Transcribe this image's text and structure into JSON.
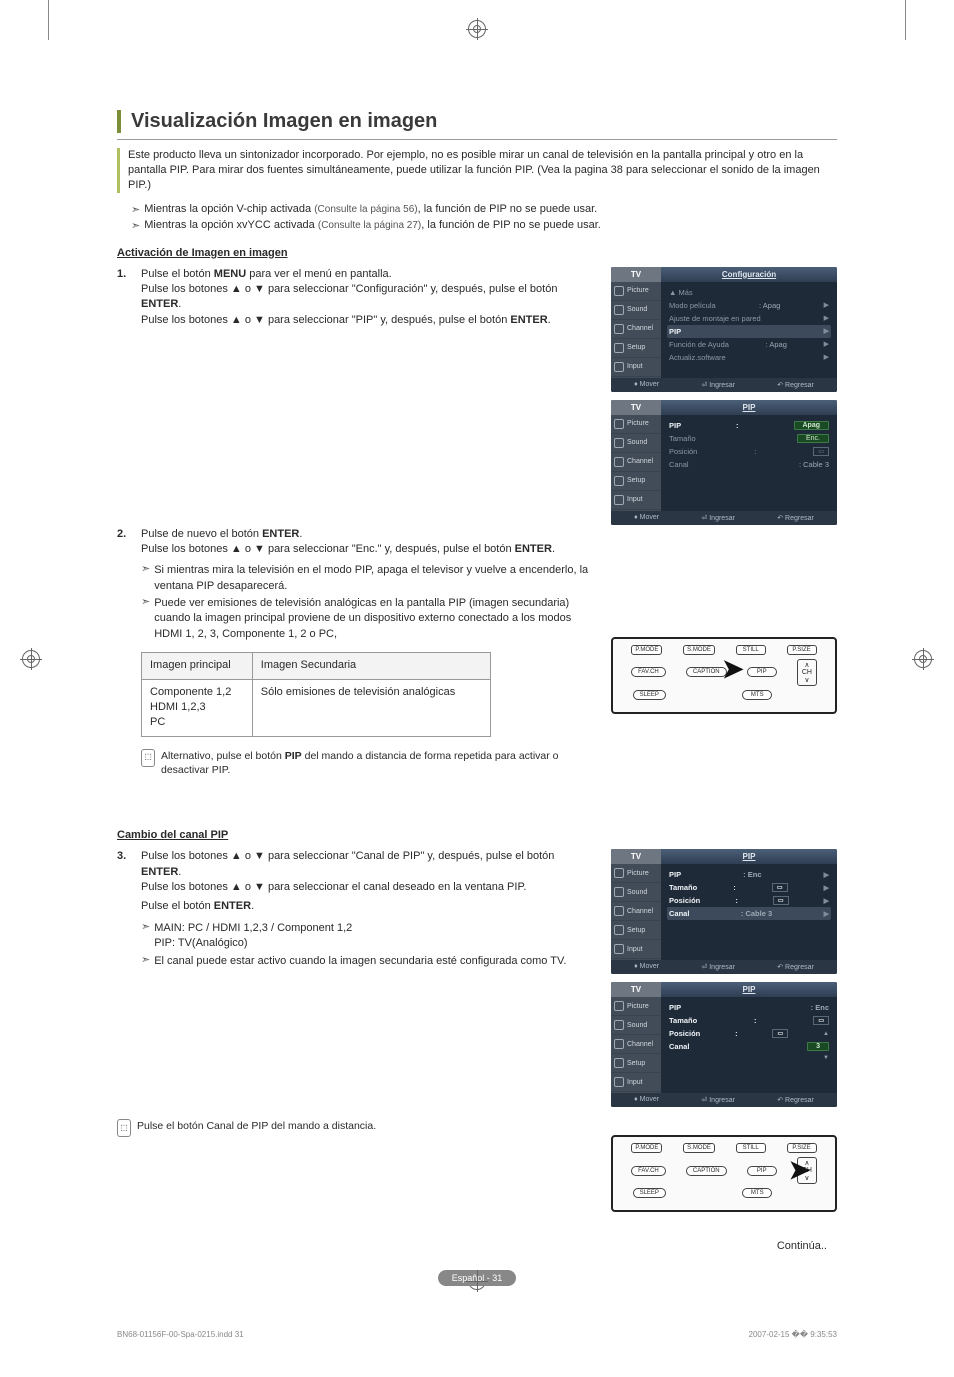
{
  "title": "Visualización Imagen en imagen",
  "intro": "Este producto lleva un sintonizador incorporado. Por ejemplo, no es posible mirar un canal de televisión en la pantalla principal y otro en la pantalla PIP. Para mirar dos fuentes simultáneamente, puede utilizar la función PIP. (Vea la pagina 38 para seleccionar el sonido de la imagen PIP.)",
  "top_notes": [
    {
      "pre": "Mientras la opción V-chip activada ",
      "paren": "(Consulte la página 56)",
      "post": ", la función de PIP no se puede usar."
    },
    {
      "pre": "Mientras la opción xvYCC activada ",
      "paren": "(Consulte la página 27)",
      "post": ", la función de PIP no se puede usar."
    }
  ],
  "section1_head": "Activación de Imagen en imagen",
  "step1": {
    "num": "1.",
    "l1a": "Pulse el botón ",
    "l1b": "MENU",
    "l1c": " para ver el menú en pantalla.",
    "l2": "Pulse los botones ▲ o ▼ para seleccionar \"Configuración\" y, después, pulse el botón ",
    "enter1": "ENTER",
    "l2end": ".",
    "l3": "Pulse los botones ▲ o ▼ para seleccionar \"PIP\" y, después, pulse el botón ",
    "enter2": "ENTER",
    "l3end": "."
  },
  "step2": {
    "num": "2.",
    "l1a": "Pulse de nuevo el botón ",
    "enter1": "ENTER",
    "l1b": ".",
    "l2": "Pulse los botones ▲ o ▼ para seleccionar \"Enc.\" y, después, pulse el botón ",
    "enter2": "ENTER",
    "l2end": ".",
    "sub1": "Si mientras mira la televisión en el modo PIP, apaga el televisor y vuelve a encenderlo, la ventana PIP desaparecerá.",
    "sub2": "Puede ver emisiones de televisión analógicas en la pantalla PIP (imagen secundaria) cuando la imagen principal proviene de un dispositivo externo conectado a los modos HDMI 1, 2, 3, Componente 1, 2 o PC,"
  },
  "pip_table": {
    "h1": "Imagen principal",
    "h2": "Imagen Secundaria",
    "c1": "Componente 1,2\nHDMI 1,2,3\nPC",
    "c2": "Sólo emisiones de televisión analógicas"
  },
  "remote_note1a": "Alternativo, pulse el botón ",
  "remote_note1b": "PIP",
  "remote_note1c": " del mando a distancia de forma repetida para activar o desactivar PIP.",
  "section2_head": "Cambio del canal PIP",
  "step3": {
    "num": "3.",
    "l1": "Pulse los botones ▲ o ▼ para seleccionar \"Canal de PIP\" y, después, pulse el botón ",
    "enter1": "ENTER",
    "l1end": ".",
    "l2": "Pulse los botones ▲ o ▼ para seleccionar el canal deseado en la ventana PIP.",
    "l3a": "Pulse el botón ",
    "enter2": "ENTER",
    "l3b": ".",
    "sub1": "MAIN: PC / HDMI 1,2,3 / Component 1,2\nPIP: TV(Analógico)",
    "sub2": "El canal puede estar activo cuando la imagen secundaria esté configurada como TV."
  },
  "remote_note2": "Pulse el botón Canal de PIP del mando a distancia.",
  "continua": "Continúa..",
  "foot_pill": "Español - 31",
  "print_left": "BN68-01156F-00-Spa-0215.indd   31",
  "print_right": "2007-02-15   �� 9:35:53",
  "osd": {
    "tv": "TV",
    "side": [
      "Picture",
      "Sound",
      "Channel",
      "Setup",
      "Input"
    ],
    "footer": {
      "mover": "Mover",
      "ingresar": "Ingresar",
      "regresar": "Regresar"
    },
    "menu1": {
      "title": "Configuración",
      "mas": "▲ Más",
      "r1l": "Modo película",
      "r1v": ": Apag",
      "r2l": "Ajuste de montaje en pared",
      "r3l": "PIP",
      "r4l": "Función de Ayuda",
      "r4v": ": Apag",
      "r5l": "Actualiz.software"
    },
    "menu2": {
      "title": "PIP",
      "r1l": "PIP",
      "r1v": "Apag",
      "r2l": "Tamaño",
      "r2v": "Enc.",
      "r3l": "Posición",
      "r4l": "Canal",
      "r4v": ": Cable 3"
    },
    "menu3": {
      "title": "PIP",
      "r1l": "PIP",
      "r1v": ": Enc",
      "r2l": "Tamaño",
      "r3l": "Posición",
      "r4l": "Canal",
      "r4v": ": Cable 3"
    },
    "menu4": {
      "title": "PIP",
      "r1l": "PIP",
      "r1v": ": Enc",
      "r2l": "Tamaño",
      "r3l": "Posición",
      "r4l": "Canal",
      "r4v": "3"
    }
  },
  "remote": {
    "row1": [
      "P.MODE",
      "S.MODE",
      "STILL",
      "P.SIZE"
    ],
    "row2": [
      "FAV.CH",
      "CAPTION",
      "PIP"
    ],
    "row3": [
      "SLEEP",
      "",
      "MTS"
    ],
    "ch": "CH"
  }
}
